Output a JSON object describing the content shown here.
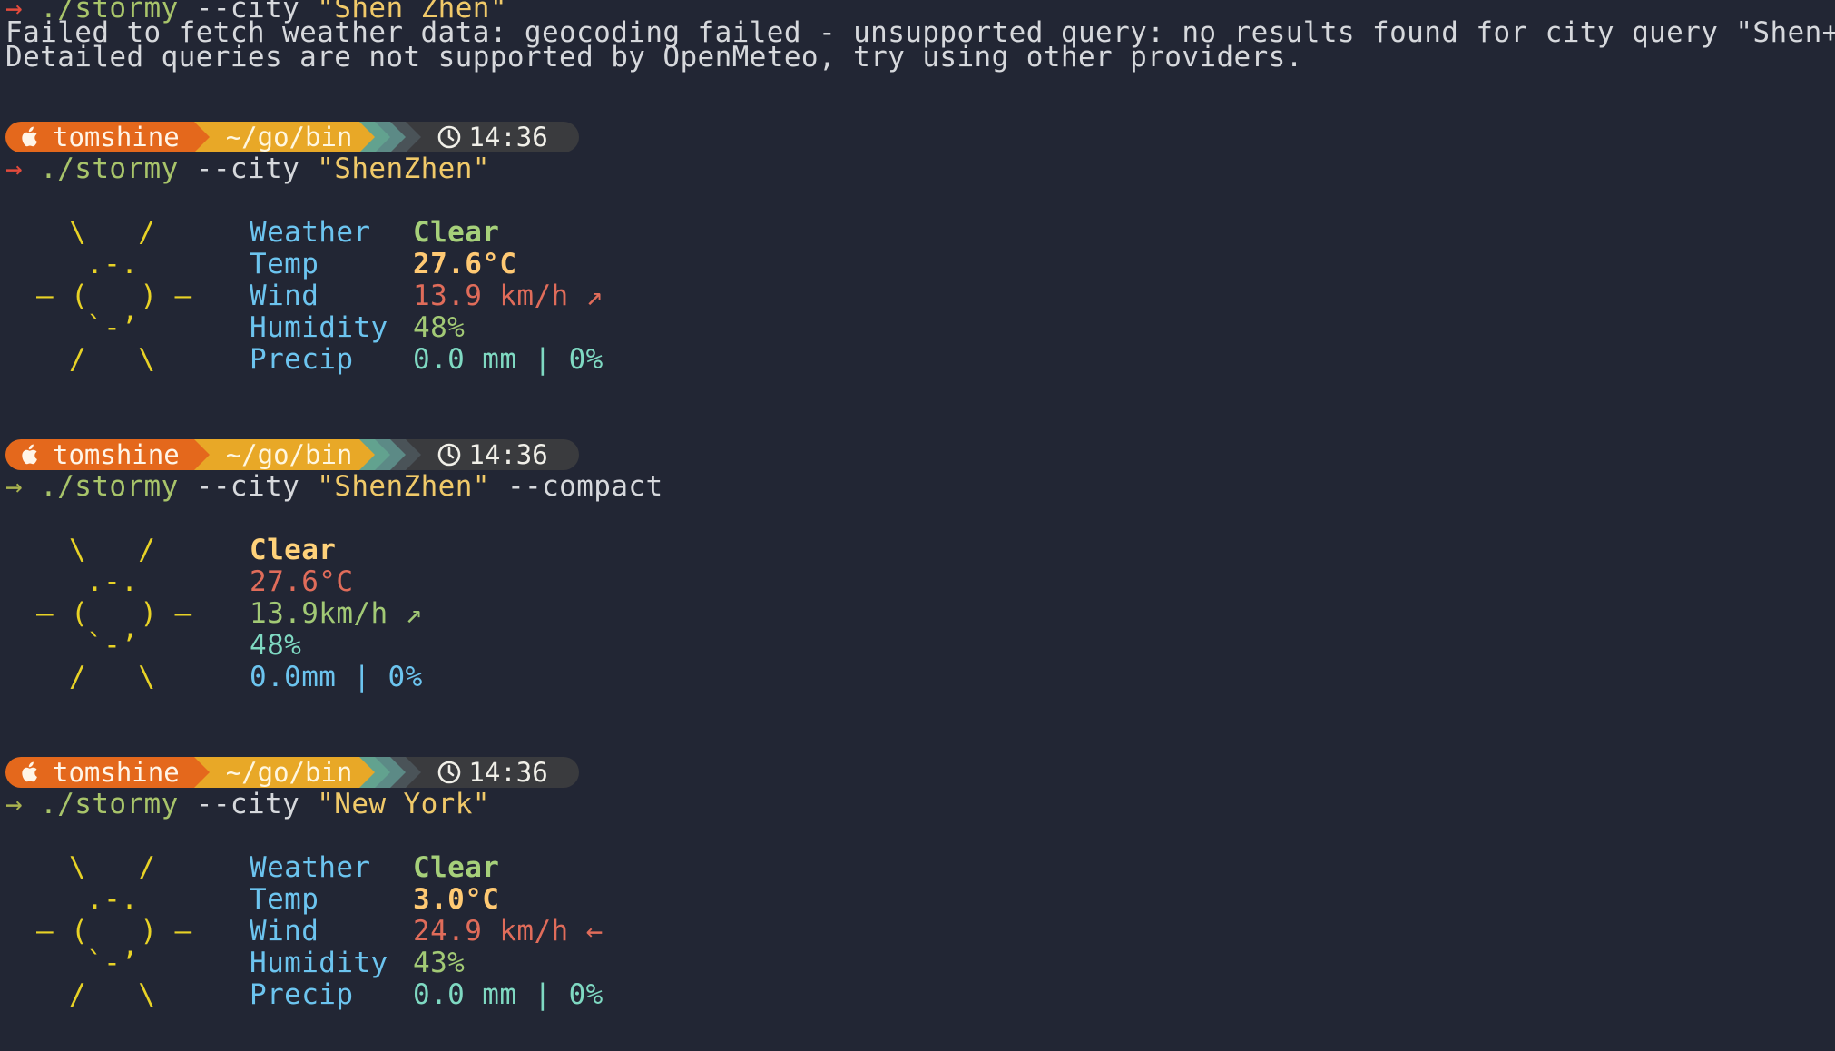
{
  "prompt": {
    "user": "tomshine",
    "path": "~/go/bin",
    "time": "14:36",
    "arrow": "→"
  },
  "cmd1": {
    "bin": "./stormy",
    "flag": "--city",
    "arg": "\"Shen Zhen\"",
    "error1": "Failed to fetch weather data: geocoding failed - unsupported query: no results found for city query \"Shen+Zhen\"",
    "error2": "Detailed queries are not supported by OpenMeteo, try using other providers."
  },
  "cmd2": {
    "bin": "./stormy",
    "flag": "--city",
    "arg": "\"ShenZhen\"",
    "labels": [
      "Weather",
      "Temp",
      "Wind",
      "Humidity",
      "Precip"
    ],
    "weather": "Clear",
    "temp": "27.6°C",
    "wind": "13.9 km/h ↗",
    "humidity": "48%",
    "precip": "0.0 mm | 0%"
  },
  "cmd3": {
    "bin": "./stormy",
    "flag": "--city",
    "arg": "\"ShenZhen\"",
    "flag2": "--compact",
    "weather": "Clear",
    "temp": "27.6°C",
    "wind": "13.9km/h ↗",
    "humidity": "48%",
    "precip": "0.0mm | 0%"
  },
  "cmd4": {
    "bin": "./stormy",
    "flag": "--city",
    "arg": "\"New York\"",
    "labels": [
      "Weather",
      "Temp",
      "Wind",
      "Humidity",
      "Precip"
    ],
    "weather": "Clear",
    "temp": "3.0°C",
    "wind": "24.9 km/h ←",
    "humidity": "43%",
    "precip": "0.0 mm | 0%"
  },
  "sun_art": [
    "\\   /",
    " .-.",
    "‒ (   ) ‒",
    " `-’",
    "/   \\"
  ],
  "colors": {
    "background": "#222634",
    "user_segment": "#e4681c",
    "path_segment": "#e8a827",
    "time_segment": "#3a3b3e"
  }
}
